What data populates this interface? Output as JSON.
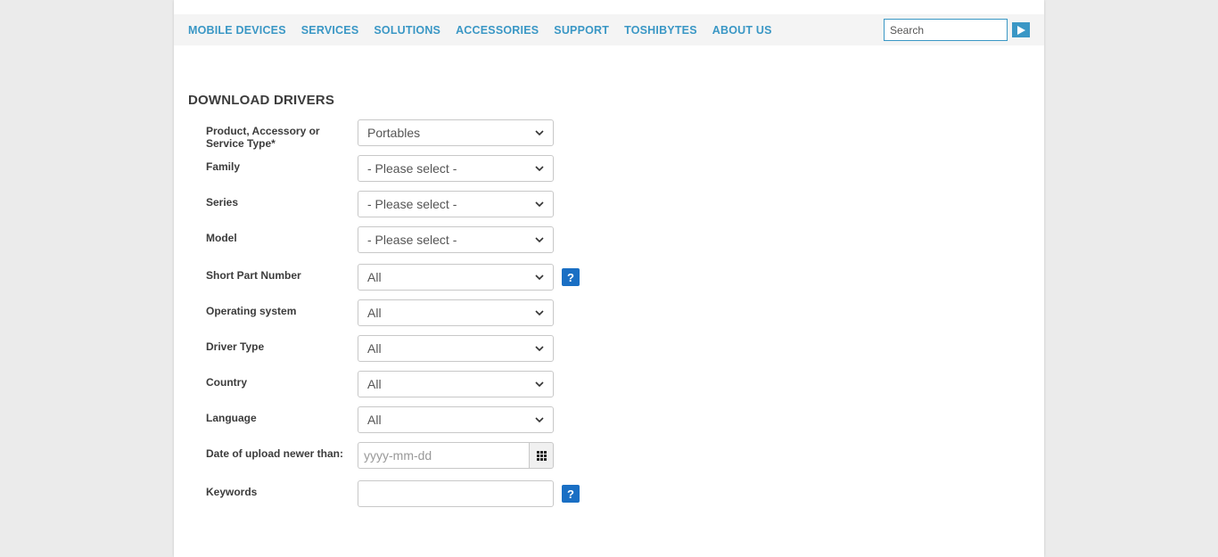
{
  "nav": {
    "items": [
      "MOBILE DEVICES",
      "SERVICES",
      "SOLUTIONS",
      "ACCESSORIES",
      "SUPPORT",
      "TOSHIBYTES",
      "ABOUT US"
    ],
    "search_placeholder": "Search",
    "accent_color": "#3a97c5"
  },
  "page_title": "DOWNLOAD DRIVERS",
  "form": {
    "product_type": {
      "label": "Product, Accessory or Service Type*",
      "value": "Portables"
    },
    "family": {
      "label": "Family",
      "value": "- Please select -"
    },
    "series": {
      "label": "Series",
      "value": "- Please select -"
    },
    "model": {
      "label": "Model",
      "value": "- Please select -"
    },
    "short_part_number": {
      "label": "Short Part Number",
      "value": "All",
      "help": "?"
    },
    "operating_system": {
      "label": "Operating system",
      "value": "All"
    },
    "driver_type": {
      "label": "Driver Type",
      "value": "All"
    },
    "country": {
      "label": "Country",
      "value": "All"
    },
    "language": {
      "label": "Language",
      "value": "All"
    },
    "upload_date": {
      "label": "Date of upload newer than:",
      "placeholder": "yyyy-mm-dd"
    },
    "keywords": {
      "label": "Keywords",
      "value": "",
      "help": "?"
    }
  },
  "icons": {
    "search_submit": "play-arrow-icon",
    "calendar": "calendar-grid-icon",
    "dropdown": "chevron-down-icon"
  }
}
